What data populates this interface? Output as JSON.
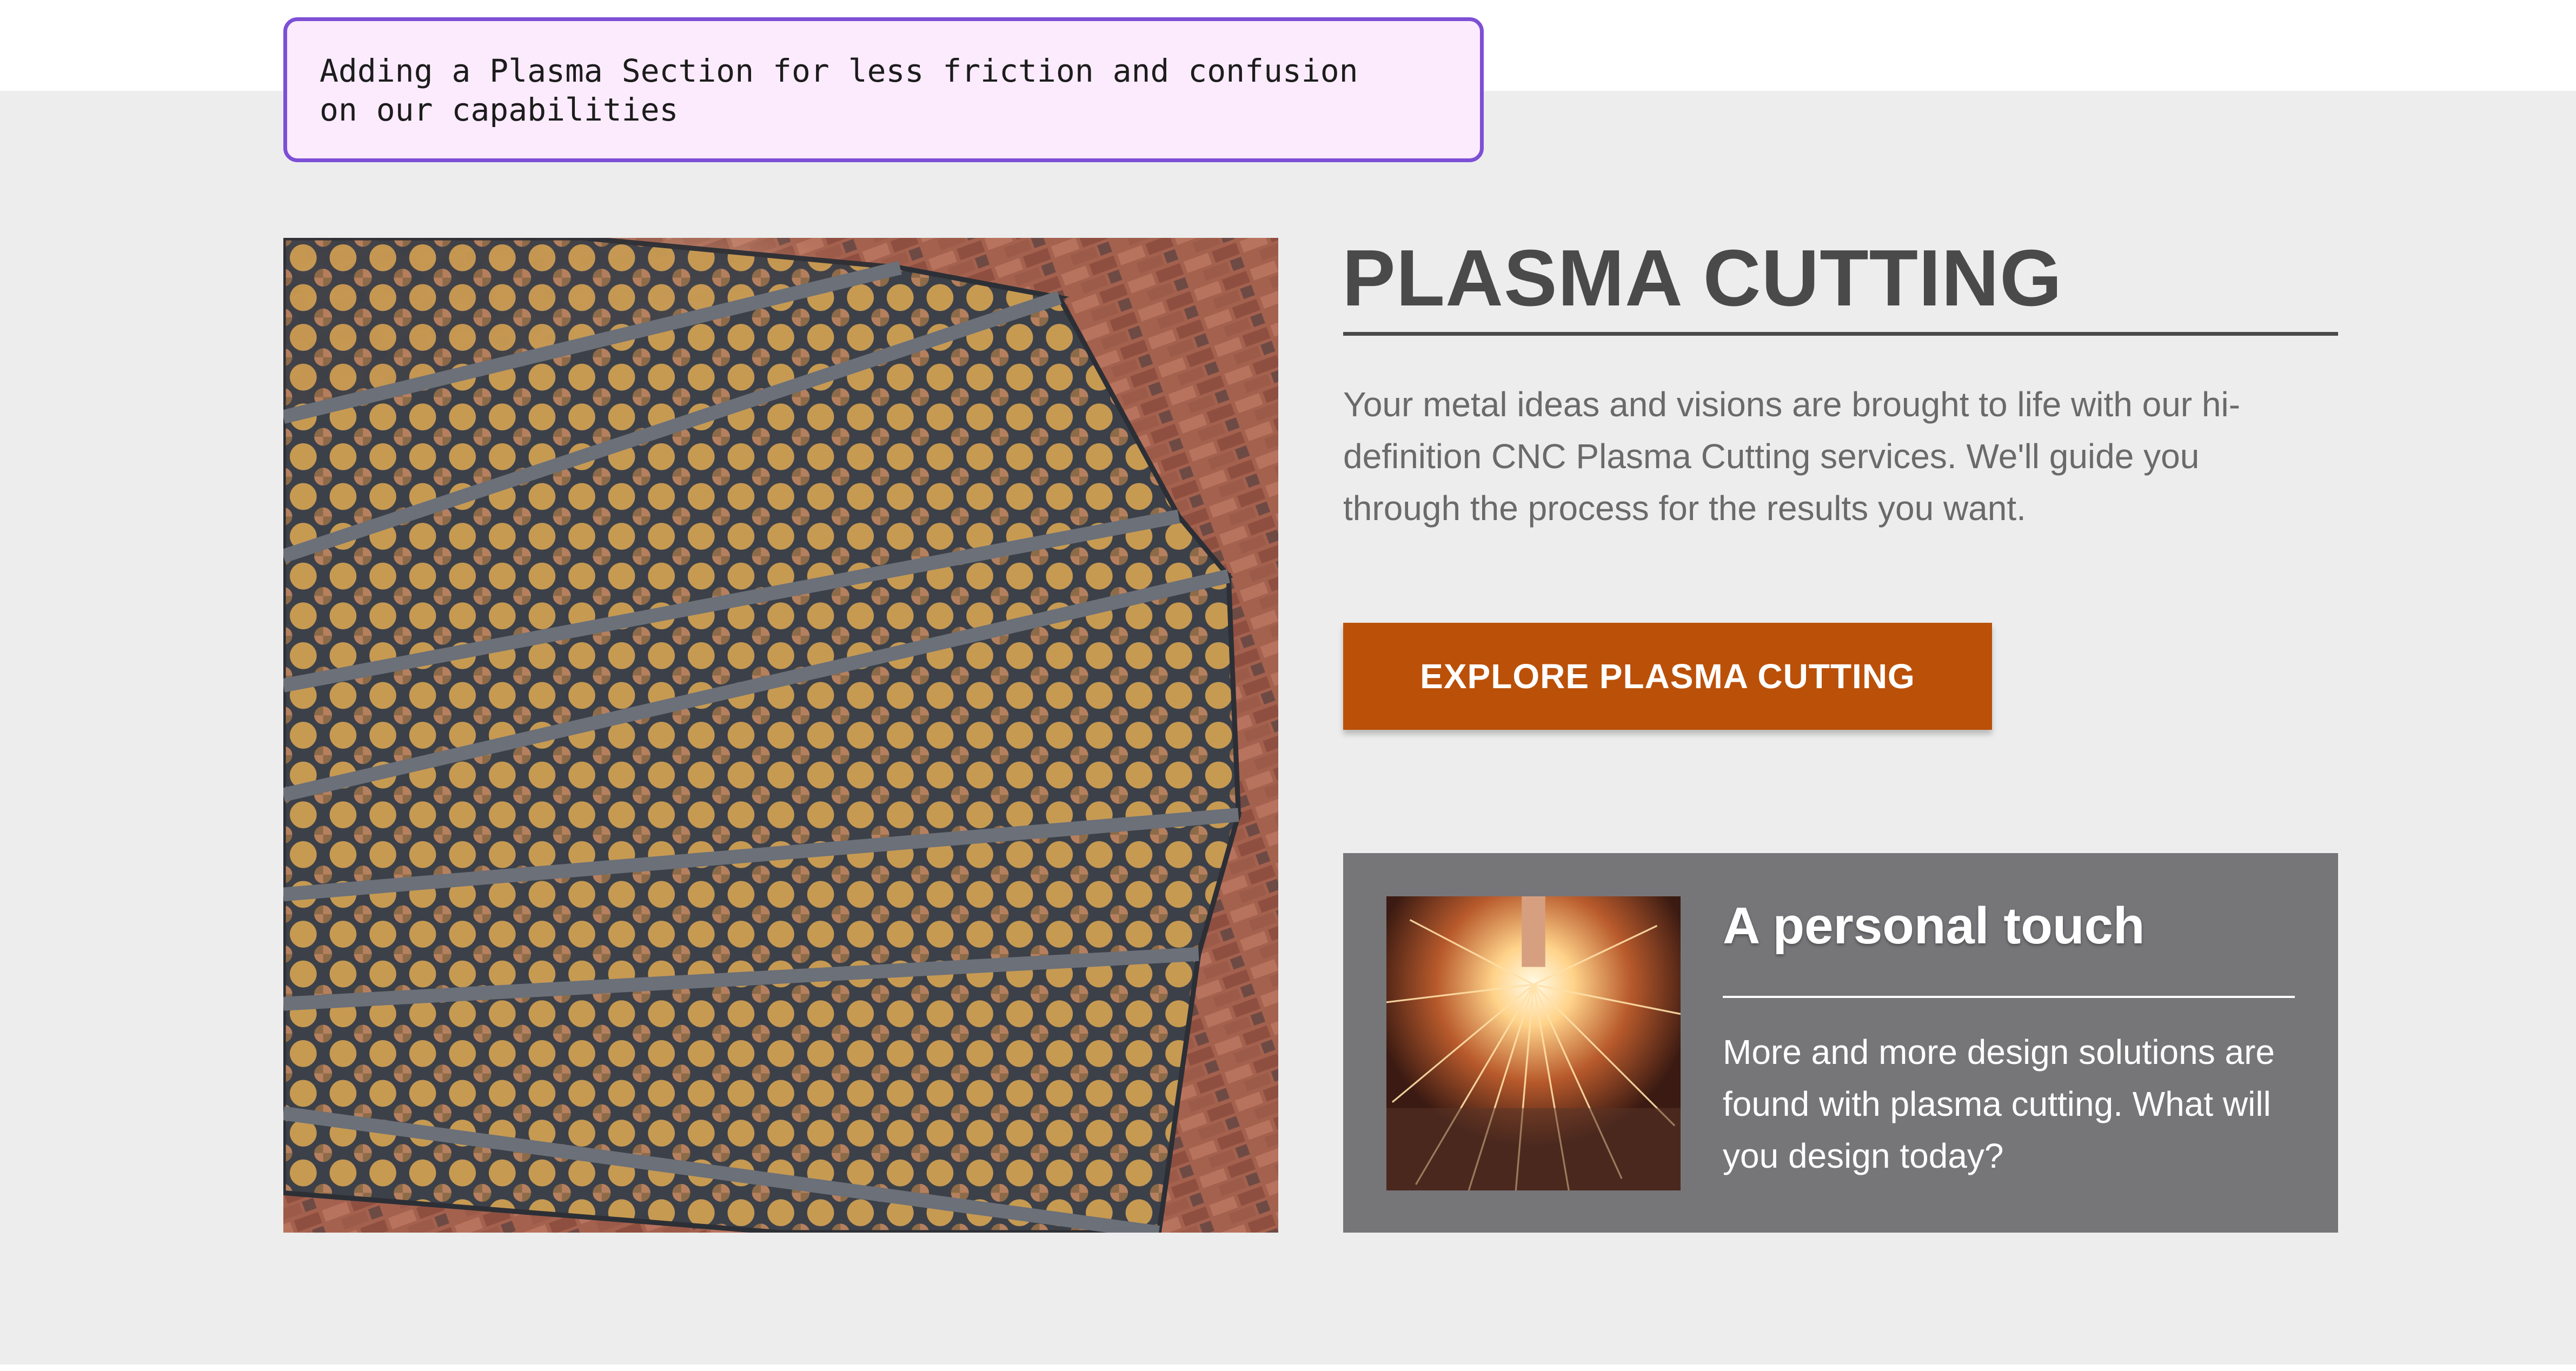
{
  "annotation": {
    "text_line1": "Adding a Plasma Section for less friction and confusion",
    "text_line2": "on our capabilities",
    "border_color": "#7d4fd6",
    "background_color": "#fbebfd"
  },
  "section": {
    "background_color": "#ededed",
    "image_subject": "spiral cast iron staircase against brick wall",
    "title": "PLASMA CUTTING",
    "description": "Your metal ideas and visions are brought to life with our hi-definition CNC Plasma Cutting services. We'll guide you through the process for the results you want.",
    "cta_label": "EXPLORE PLASMA CUTTING",
    "cta_color": "#bb5008"
  },
  "card": {
    "background_color": "#767679",
    "image_subject": "plasma cutter torch throwing sparks",
    "title": "A personal touch",
    "text": "More and more design solutions are found with plasma cutting. What will you design today?"
  }
}
